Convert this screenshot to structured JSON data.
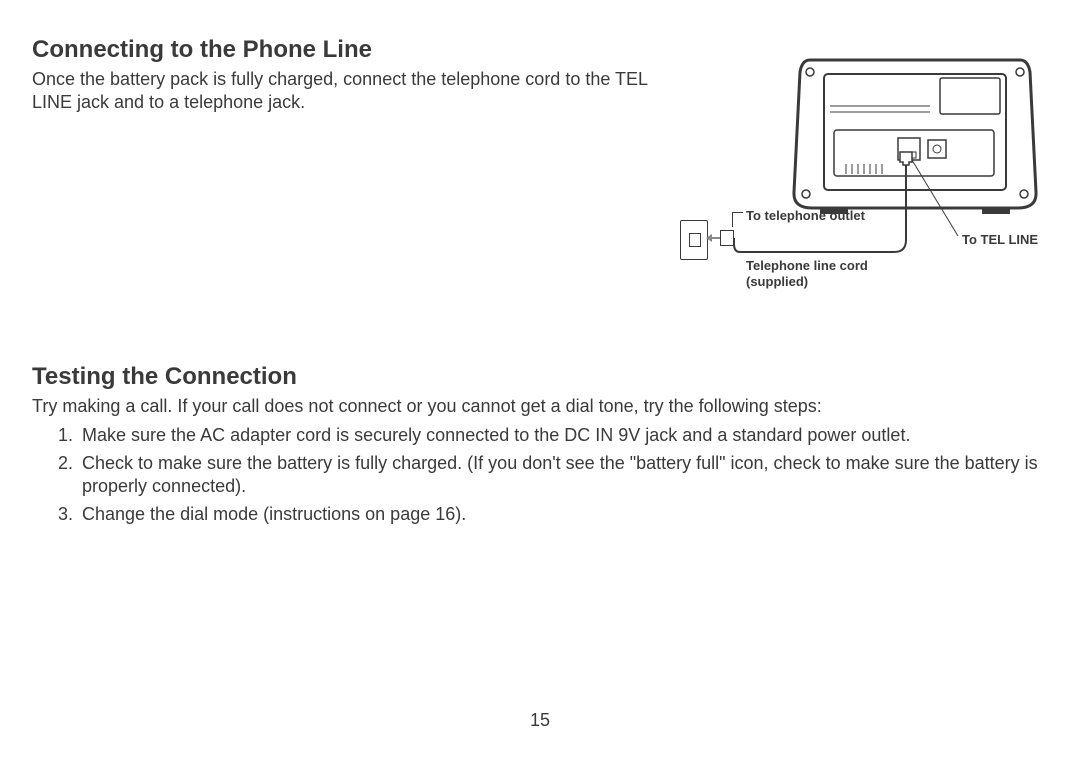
{
  "section1": {
    "title": "Connecting to the Phone Line",
    "intro": "Once the battery pack is fully charged, connect the telephone cord to the TEL LINE jack and to a telephone jack."
  },
  "figure": {
    "label_outlet": "To telephone outlet",
    "label_telline": "To TEL LINE",
    "label_cord": "Telephone line cord (supplied)"
  },
  "section2": {
    "title": "Testing the Connection",
    "intro": "Try making a call. If your call does not connect or you cannot get a dial tone, try the following steps:",
    "steps": [
      "Make sure the AC adapter cord is securely connected to the DC IN 9V jack and a standard power outlet.",
      "Check to make sure the battery is fully charged. (If you don't see the \"battery full\" icon, check to make sure the battery is properly connected).",
      "Change the dial mode (instructions on page 16)."
    ]
  },
  "page_number": "15"
}
